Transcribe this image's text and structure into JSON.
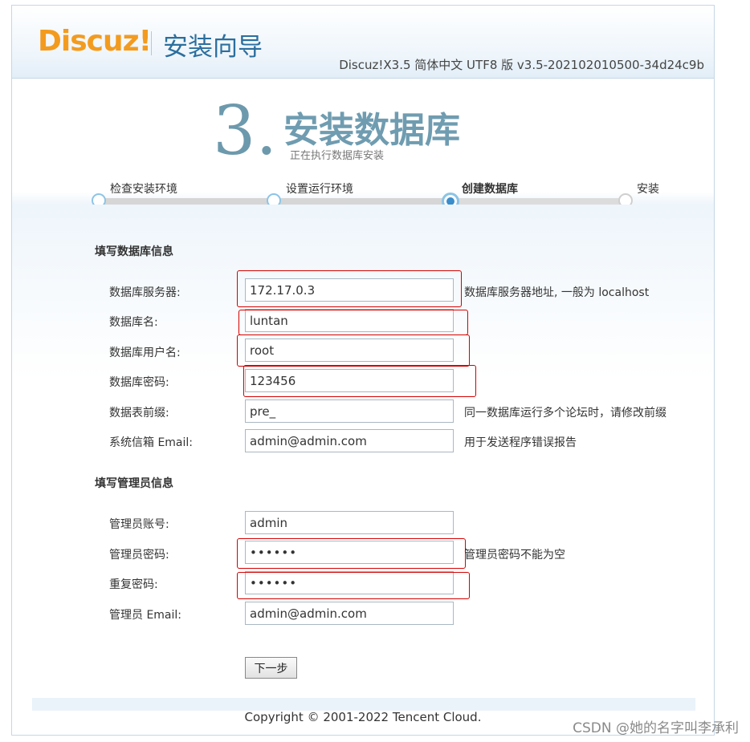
{
  "header": {
    "logo_text": "Discuz!",
    "wizard_title": "安装向导",
    "version": "Discuz!X3.5 简体中文 UTF8 版 v3.5-202102010500-34d24c9b"
  },
  "step": {
    "number": "3.",
    "title": "安装数据库",
    "subtitle": "正在执行数据库安装",
    "steps": [
      "检查安装环境",
      "设置运行环境",
      "创建数据库",
      "安装"
    ],
    "current_index": 2
  },
  "db_section": {
    "title": "填写数据库信息",
    "host_label": "数据库服务器:",
    "host_value": "172.17.0.3",
    "host_help": "数据库服务器地址, 一般为 localhost",
    "name_label": "数据库名:",
    "name_value": "luntan",
    "user_label": "数据库用户名:",
    "user_value": "root",
    "pass_label": "数据库密码:",
    "pass_value": "123456",
    "prefix_label": "数据表前缀:",
    "prefix_value": "pre_",
    "prefix_help": "同一数据库运行多个论坛时，请修改前缀",
    "email_label": "系统信箱 Email:",
    "email_value": "admin@admin.com",
    "email_help": "用于发送程序错误报告"
  },
  "admin_section": {
    "title": "填写管理员信息",
    "account_label": "管理员账号:",
    "account_value": "admin",
    "password_label": "管理员密码:",
    "password_value": "••••••",
    "password_help": "管理员密码不能为空",
    "repeat_label": "重复密码:",
    "repeat_value": "••••••",
    "email_label": "管理员 Email:",
    "email_value": "admin@admin.com"
  },
  "actions": {
    "next_label": "下一步"
  },
  "footer": {
    "copyright": "Copyright © 2001-2022 Tencent Cloud."
  },
  "watermark": "CSDN @她的名字叫李承利",
  "colors": {
    "highlight": "#d40000",
    "accent": "#3a8ecb",
    "logo": "#f39b1f"
  }
}
